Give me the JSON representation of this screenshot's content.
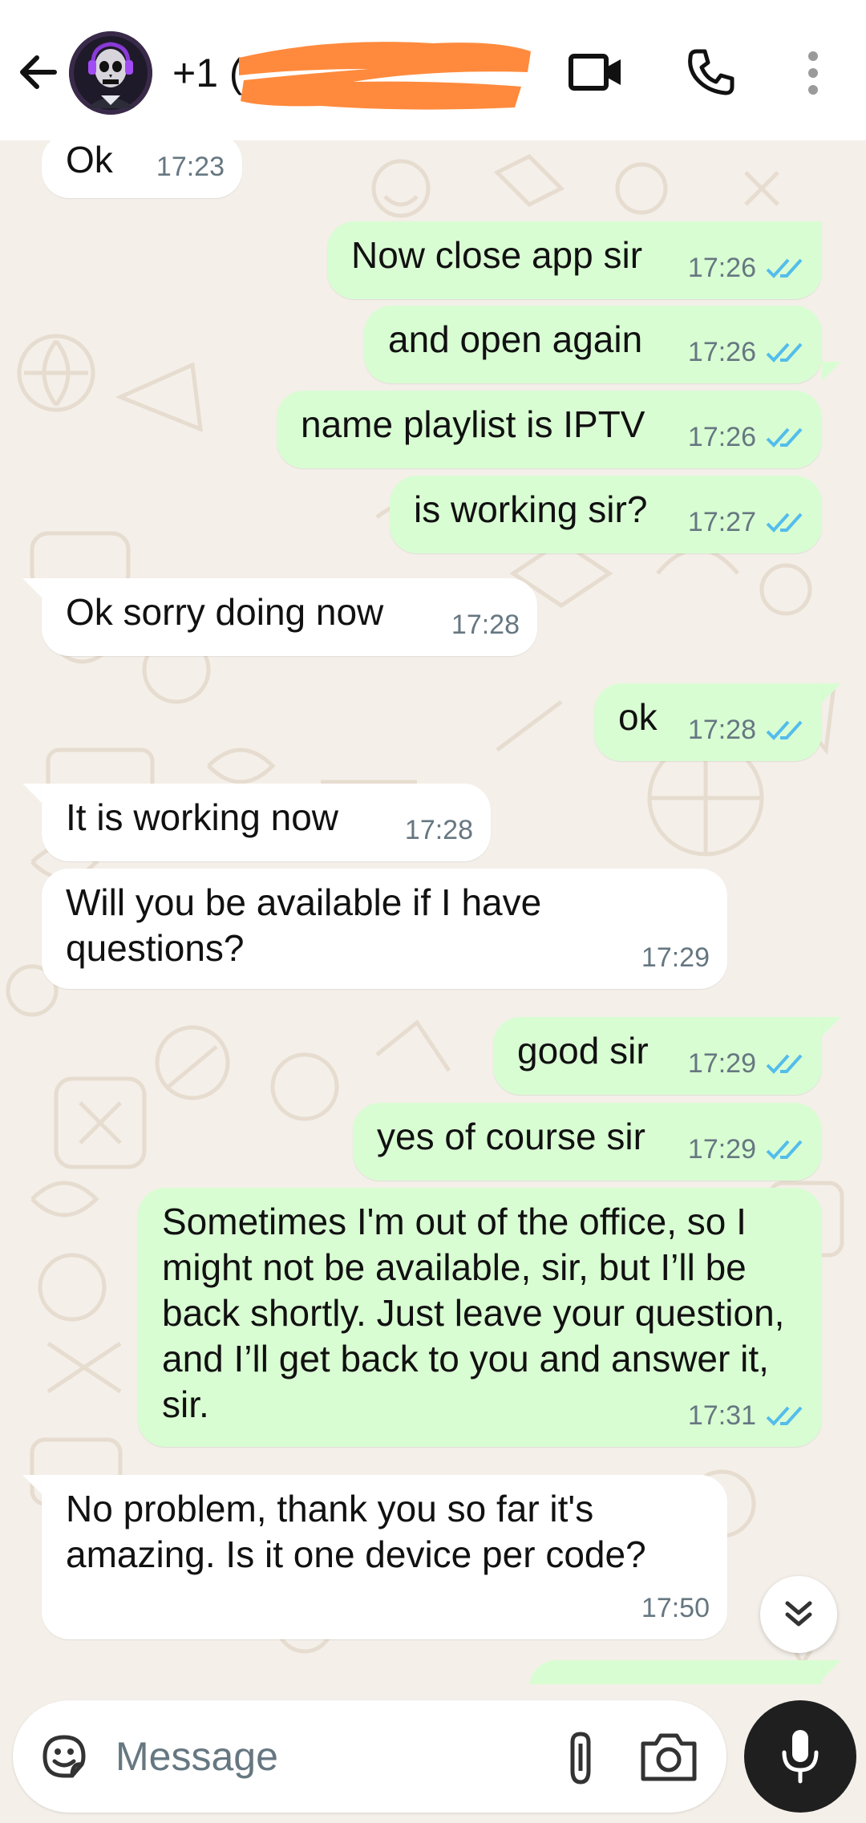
{
  "header": {
    "contact_name": "+1 (",
    "icons": [
      "back-arrow-icon",
      "video-call-icon",
      "voice-call-icon",
      "more-options-icon"
    ]
  },
  "messages": [
    {
      "dir": "in",
      "text": "Ok",
      "time": "17:23"
    },
    {
      "dir": "out",
      "text": "Now close app sir",
      "time": "17:26",
      "status": "read"
    },
    {
      "dir": "out",
      "text": "and open again",
      "time": "17:26",
      "status": "read"
    },
    {
      "dir": "out",
      "text": "name playlist is IPTV",
      "time": "17:26",
      "status": "read"
    },
    {
      "dir": "out",
      "text": "is working sir?",
      "time": "17:27",
      "status": "read"
    },
    {
      "dir": "in",
      "text": "Ok sorry doing now",
      "time": "17:28"
    },
    {
      "dir": "out",
      "text": "ok",
      "time": "17:28",
      "status": "read"
    },
    {
      "dir": "in",
      "text": "It is working now",
      "time": "17:28"
    },
    {
      "dir": "in",
      "text": "Will you be available if I have questions?",
      "time": "17:29"
    },
    {
      "dir": "out",
      "text": "good sir",
      "time": "17:29",
      "status": "read"
    },
    {
      "dir": "out",
      "text": "yes of course sir",
      "time": "17:29",
      "status": "read"
    },
    {
      "dir": "out",
      "text": "Sometimes I'm out of the office, so I might not be available, sir, but I’ll be back shortly. Just leave your question, and I’ll get back to you and answer it, sir.",
      "time": "17:31",
      "status": "read"
    },
    {
      "dir": "in",
      "text": "No problem, thank you so far it's amazing. Is it one device per code?",
      "time": "17:50"
    }
  ],
  "composer": {
    "placeholder": "Message"
  },
  "colors": {
    "outgoing_bubble": "#D9FDD3",
    "incoming_bubble": "#FFFFFF",
    "chat_background": "#F4EFE9",
    "read_tick": "#53BDEB",
    "redaction": "#FF8A3D",
    "mic_button": "#1F1F1F"
  }
}
